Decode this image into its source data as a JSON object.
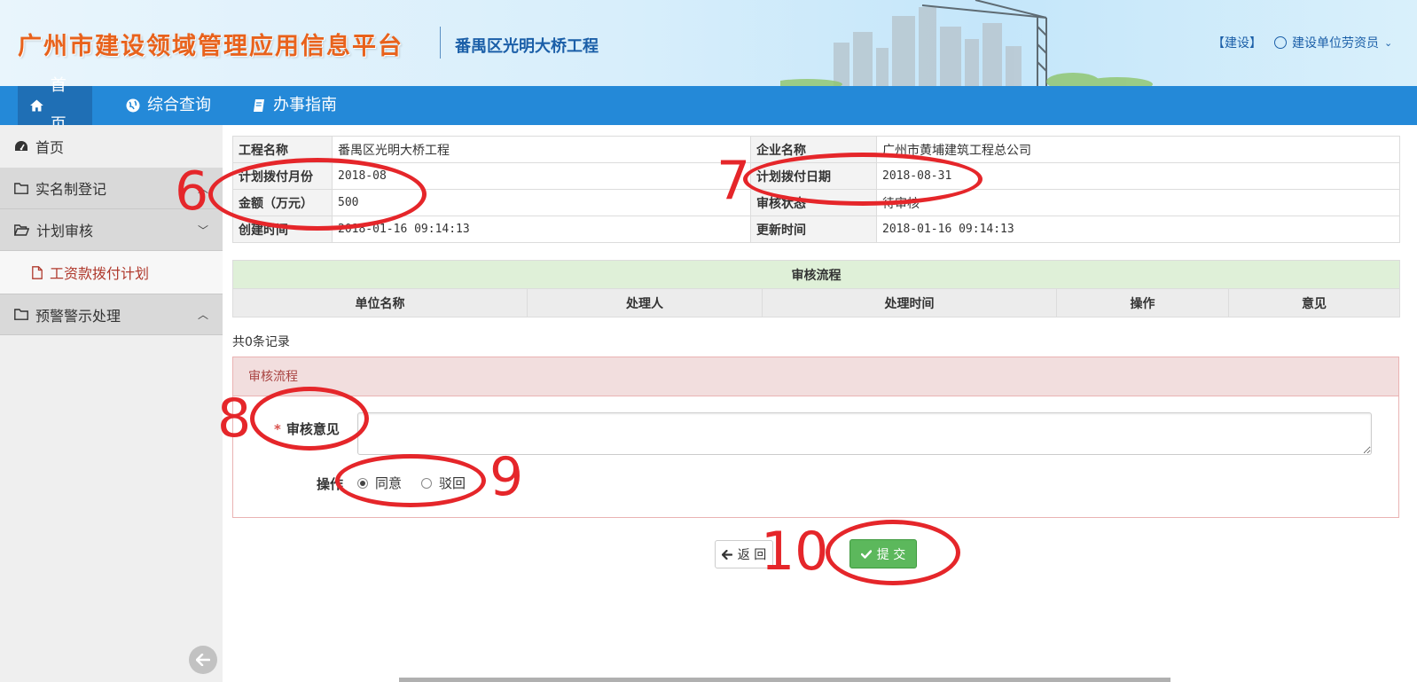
{
  "header": {
    "platform_title": "广州市建设领域管理应用信息平台",
    "project_name": "番禺区光明大桥工程",
    "role_tag": "【建设】",
    "user_name": "建设单位劳资员"
  },
  "nav": {
    "items": [
      {
        "label": "首页",
        "icon": "home-icon",
        "active": true
      },
      {
        "label": "综合查询",
        "icon": "globe-icon",
        "active": false
      },
      {
        "label": "办事指南",
        "icon": "book-icon",
        "active": false
      }
    ]
  },
  "sidebar": {
    "home": "首页",
    "groups": [
      {
        "label": "实名制登记",
        "expanded": false
      },
      {
        "label": "计划审核",
        "expanded": true
      },
      {
        "label": "预警警示处理",
        "expanded": false
      }
    ],
    "sub_item": "工资款拨付计划"
  },
  "info": {
    "project_name_label": "工程名称",
    "project_name_value": "番禺区光明大桥工程",
    "company_label": "企业名称",
    "company_value": "广州市黄埔建筑工程总公司",
    "plan_month_label": "计划拨付月份",
    "plan_month_value": "2018-08",
    "plan_date_label": "计划拨付日期",
    "plan_date_value": "2018-08-31",
    "amount_label": "金额（万元）",
    "amount_value": "500",
    "status_label": "审核状态",
    "status_value": "待审核",
    "created_label": "创建时间",
    "created_value": "2018-01-16 09:14:13",
    "updated_label": "更新时间",
    "updated_value": "2018-01-16 09:14:13"
  },
  "flow": {
    "title": "审核流程",
    "columns": [
      "单位名称",
      "处理人",
      "处理时间",
      "操作",
      "意见"
    ],
    "rows": [],
    "record_count": "共0条记录"
  },
  "review": {
    "panel_title": "审核流程",
    "opinion_label": "审核意见",
    "required_mark": "*",
    "opinion_value": "",
    "action_label": "操作",
    "options": [
      {
        "label": "同意",
        "checked": true
      },
      {
        "label": "驳回",
        "checked": false
      }
    ]
  },
  "buttons": {
    "back": "返 回",
    "submit": "提 交"
  },
  "annotations": [
    "6",
    "7",
    "8",
    "9",
    "10"
  ],
  "colors": {
    "nav_bg": "#2489d8",
    "accent_blue": "#1b5fa8",
    "annotation_red": "#e5262a",
    "submit_green": "#5cb85c",
    "panel_red_bg": "#f2dede",
    "flow_green_bg": "#dff0d8"
  }
}
